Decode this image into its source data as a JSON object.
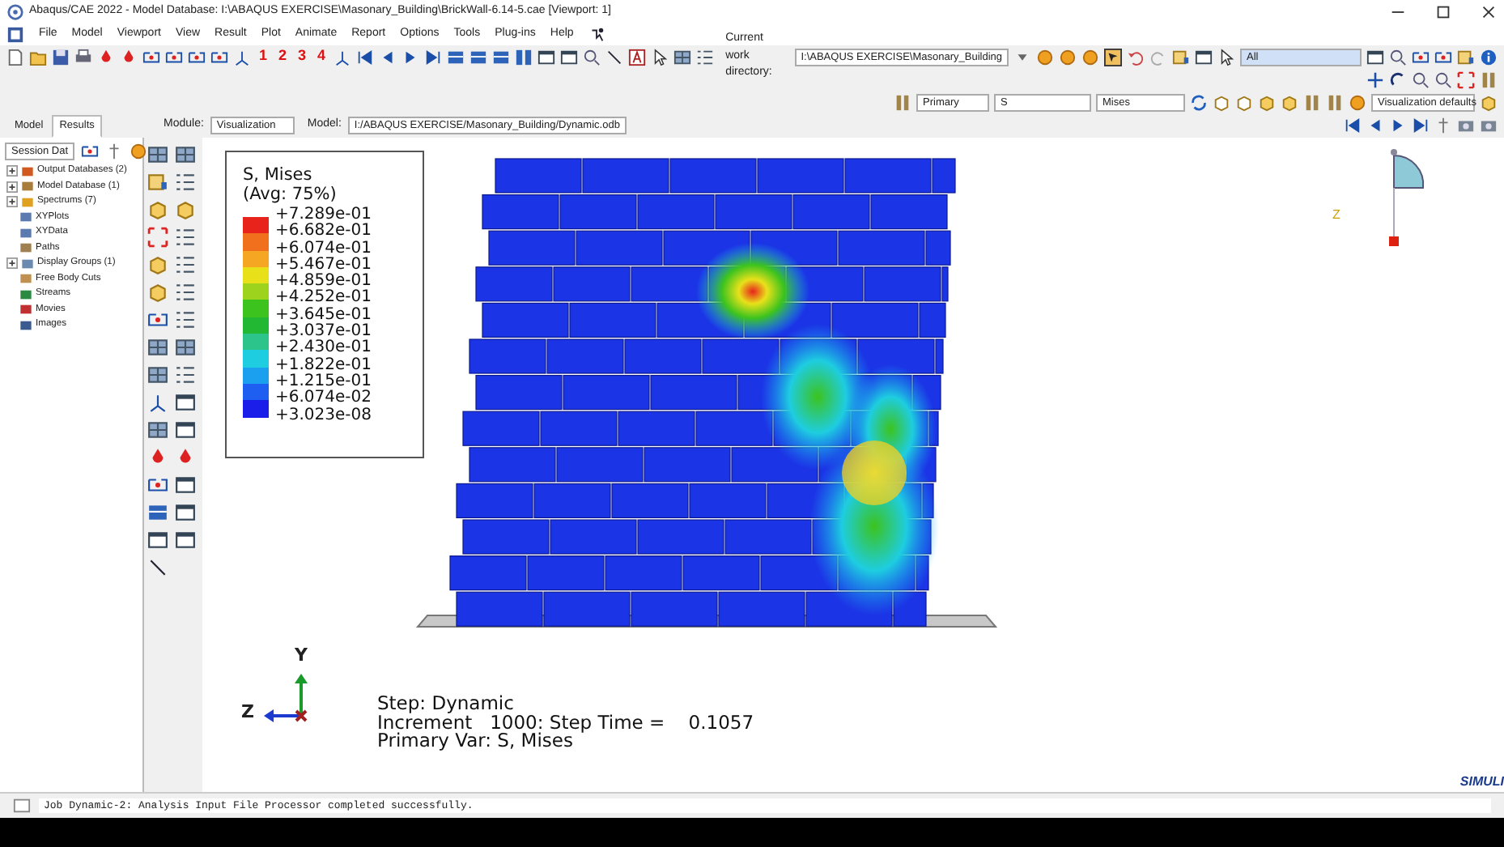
{
  "window": {
    "title": "Abaqus/CAE 2022 - Model Database: I:\\ABAQUS EXERCISE\\Masonary_Building\\BrickWall-6.14-5.cae [Viewport: 1]"
  },
  "menu": [
    "File",
    "Model",
    "Viewport",
    "View",
    "Result",
    "Plot",
    "Animate",
    "Report",
    "Options",
    "Tools",
    "Plug-ins",
    "Help"
  ],
  "toolbar": {
    "viewport_numbers": [
      "1",
      "2",
      "3",
      "4"
    ],
    "work_directory_label": "Current work directory:",
    "work_directory": "I:\\ABAQUS EXERCISE\\Masonary_Building",
    "selection_filter": "All"
  },
  "field_output": {
    "step_type": "Primary",
    "variable": "S",
    "invariant": "Mises",
    "render_style": "Visualization defaults"
  },
  "tabs": [
    {
      "label": "Model",
      "selected": false
    },
    {
      "label": "Results",
      "selected": true
    }
  ],
  "context": {
    "module_label": "Module:",
    "module": "Visualization",
    "model_label": "Model:",
    "model": "I:/ABAQUS EXERCISE/Masonary_Building/Dynamic.odb"
  },
  "session": {
    "dropdown": "Session Dat",
    "tree": [
      {
        "label": "Output Databases (2)",
        "kind": "group",
        "expanded": false
      },
      {
        "label": "Model Database (1)",
        "kind": "group",
        "expanded": false
      },
      {
        "label": "Spectrums (7)",
        "kind": "group",
        "expanded": false
      },
      {
        "label": "XYPlots",
        "kind": "leaf"
      },
      {
        "label": "XYData",
        "kind": "leaf"
      },
      {
        "label": "Paths",
        "kind": "leaf"
      },
      {
        "label": "Display Groups (1)",
        "kind": "group",
        "expanded": false
      },
      {
        "label": "Free Body Cuts",
        "kind": "leaf"
      },
      {
        "label": "Streams",
        "kind": "leaf"
      },
      {
        "label": "Movies",
        "kind": "leaf"
      },
      {
        "label": "Images",
        "kind": "leaf"
      }
    ]
  },
  "legend": {
    "title": "S, Mises",
    "average": "(Avg: 75%)",
    "values": [
      "+7.289e-01",
      "+6.682e-01",
      "+6.074e-01",
      "+5.467e-01",
      "+4.859e-01",
      "+4.252e-01",
      "+3.645e-01",
      "+3.037e-01",
      "+2.430e-01",
      "+1.822e-01",
      "+1.215e-01",
      "+6.074e-02",
      "+3.023e-08"
    ],
    "bands": [
      {
        "color": "#e8231c"
      },
      {
        "color": "#f0701e"
      },
      {
        "color": "#f5a623"
      },
      {
        "color": "#e8e11a"
      },
      {
        "color": "#9dd31c"
      },
      {
        "color": "#3cc31e"
      },
      {
        "color": "#22b834"
      },
      {
        "color": "#2cc48a"
      },
      {
        "color": "#1ecde0"
      },
      {
        "color": "#1aa0ef"
      },
      {
        "color": "#1e5ef0"
      },
      {
        "color": "#1a1ee8"
      }
    ]
  },
  "triad": {
    "y": "Y",
    "z": "Z"
  },
  "view_cube": {
    "z": "Z"
  },
  "viewport_text": [
    "Step: Dynamic",
    "Increment   1000: Step Time =    0.1057",
    "Primary Var: S, Mises"
  ],
  "brand": "SIMULI",
  "message": "Job Dynamic-2: Analysis Input File Processor completed successfully."
}
